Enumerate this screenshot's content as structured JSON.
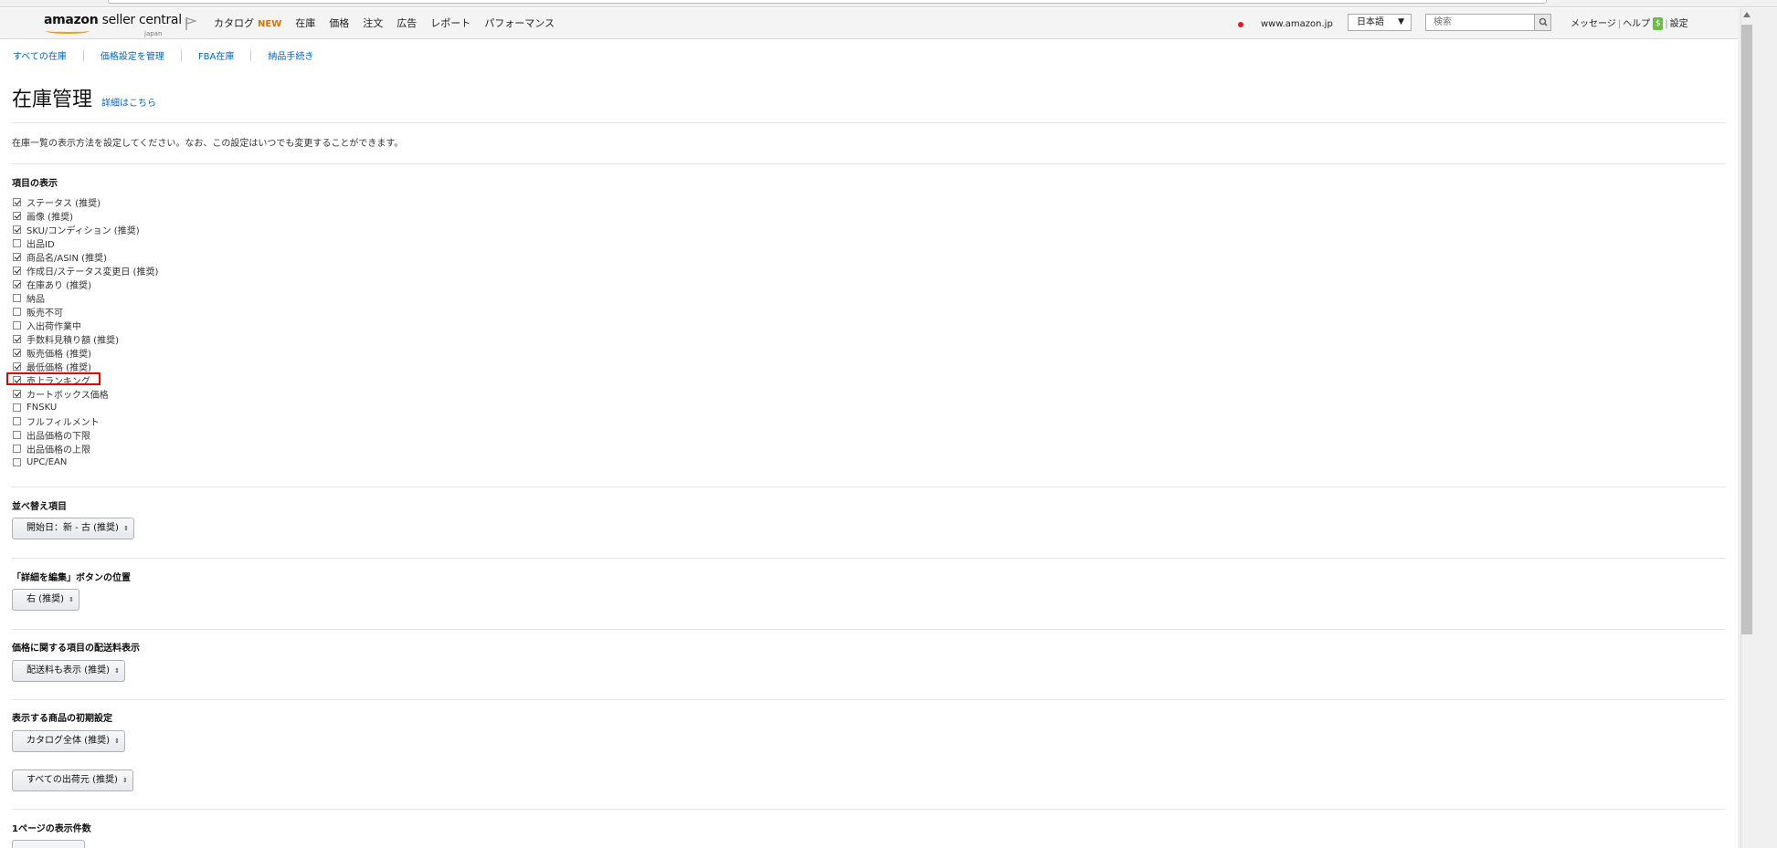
{
  "header": {
    "logo_main": "amazon",
    "logo_sub": "seller central",
    "logo_region": "japan",
    "menu": [
      "カタログ",
      "在庫",
      "価格",
      "注文",
      "広告",
      "レポート",
      "パフォーマンス"
    ],
    "new_badge": "NEW",
    "site": "www.amazon.jp",
    "language": "日本語",
    "search_placeholder": "検索",
    "messages": "メッセージ",
    "help": "ヘルプ",
    "settings": "設定",
    "dollar": "$"
  },
  "subnav": [
    "すべての在庫",
    "価格設定を管理",
    "FBA在庫",
    "納品手続き"
  ],
  "page": {
    "title": "在庫管理",
    "title_link": "詳細はこちら",
    "description": "在庫一覧の表示方法を設定してください。なお、この設定はいつでも変更することができます。"
  },
  "columns": {
    "title": "項目の表示",
    "items": [
      {
        "label": "ステータス (推奨)",
        "checked": true
      },
      {
        "label": "画像 (推奨)",
        "checked": true
      },
      {
        "label": "SKU/コンディション (推奨)",
        "checked": true
      },
      {
        "label": "出品ID",
        "checked": false
      },
      {
        "label": "商品名/ASIN (推奨)",
        "checked": true
      },
      {
        "label": "作成日/ステータス変更日 (推奨)",
        "checked": true
      },
      {
        "label": "在庫あり (推奨)",
        "checked": true
      },
      {
        "label": "納品",
        "checked": false
      },
      {
        "label": "販売不可",
        "checked": false
      },
      {
        "label": "入出荷作業中",
        "checked": false
      },
      {
        "label": "手数料見積り額 (推奨)",
        "checked": true
      },
      {
        "label": "販売価格 (推奨)",
        "checked": true
      },
      {
        "label": "最低価格 (推奨)",
        "checked": true
      },
      {
        "label": "売上ランキング",
        "checked": true
      },
      {
        "label": "カートボックス価格",
        "checked": true
      },
      {
        "label": "FNSKU",
        "checked": false
      },
      {
        "label": "フルフィルメント",
        "checked": false
      },
      {
        "label": "出品価格の下限",
        "checked": false
      },
      {
        "label": "出品価格の上限",
        "checked": false
      },
      {
        "label": "UPC/EAN",
        "checked": false
      }
    ]
  },
  "sort": {
    "title": "並べ替え項目",
    "value": "開始日：新 - 古 (推奨)"
  },
  "edit_button": {
    "title": "「詳細を編集」ボタンの位置",
    "value": "右 (推奨)"
  },
  "shipping": {
    "title": "価格に関する項目の配送料表示",
    "value": "配送料も表示 (推奨)"
  },
  "initial": {
    "title": "表示する商品の初期設定",
    "value1": "カタログ全体 (推奨)",
    "value2": "すべての出荷元 (推奨)"
  },
  "per_page": {
    "title": "1ページの表示件数"
  }
}
